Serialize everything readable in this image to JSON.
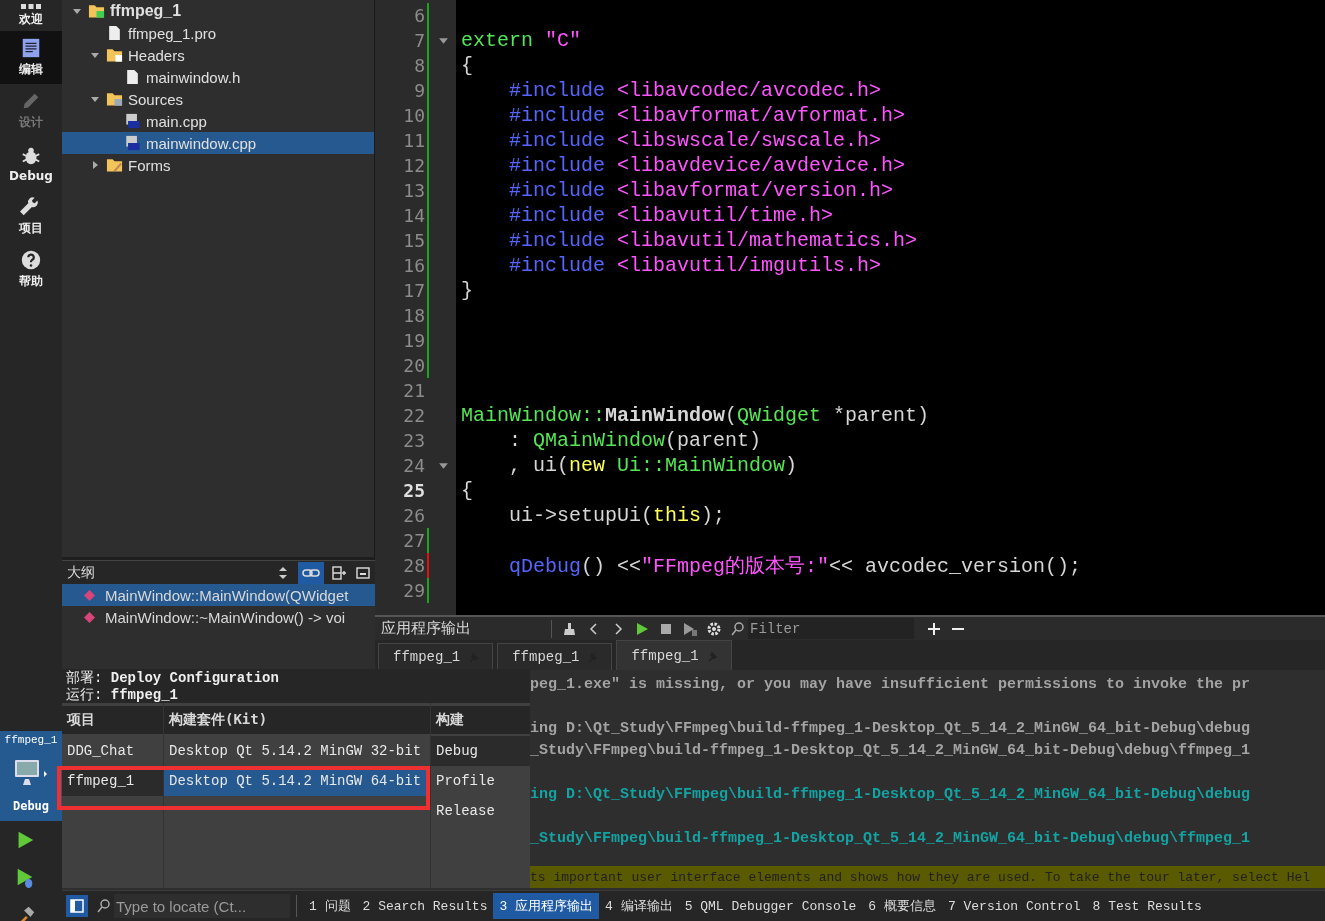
{
  "mode_bar": {
    "modes": [
      {
        "label": "欢迎",
        "kind": "welcome",
        "selected": false,
        "disabled": false
      },
      {
        "label": "编辑",
        "kind": "edit",
        "selected": true,
        "disabled": false
      },
      {
        "label": "设计",
        "kind": "design",
        "selected": false,
        "disabled": true
      },
      {
        "label": "Debug",
        "kind": "debug",
        "selected": false,
        "disabled": false
      },
      {
        "label": "项目",
        "kind": "projects",
        "selected": false,
        "disabled": false
      },
      {
        "label": "帮助",
        "kind": "help",
        "selected": false,
        "disabled": false
      }
    ],
    "kit_selector": {
      "project": "ffmpeg_1",
      "build": "Debug"
    }
  },
  "project_tree": [
    {
      "label": "ffmpeg_1",
      "kind": "project",
      "expanded": true,
      "selected": false,
      "children": [
        {
          "label": "ffmpeg_1.pro",
          "kind": "pro-file",
          "selected": false
        },
        {
          "label": "Headers",
          "kind": "header-folder",
          "expanded": true,
          "selected": false,
          "children": [
            {
              "label": "mainwindow.h",
              "kind": "header-file",
              "selected": false
            }
          ]
        },
        {
          "label": "Sources",
          "kind": "source-folder",
          "expanded": true,
          "selected": false,
          "children": [
            {
              "label": "main.cpp",
              "kind": "source-file",
              "selected": false
            },
            {
              "label": "mainwindow.cpp",
              "kind": "source-file",
              "selected": true
            }
          ]
        },
        {
          "label": "Forms",
          "kind": "form-folder",
          "expanded": false,
          "selected": false
        }
      ]
    }
  ],
  "outline": {
    "title": "大纲",
    "items": [
      {
        "label": "MainWindow::MainWindow(QWidget",
        "selected": true
      },
      {
        "label": "MainWindow::~MainWindow() -> voi",
        "selected": false
      }
    ]
  },
  "editor": {
    "lines": [
      {
        "number": "6",
        "fold": false,
        "current": false,
        "added": true,
        "modified": false
      },
      {
        "number": "7",
        "fold": true,
        "current": false,
        "added": true,
        "modified": false,
        "tokens": [
          {
            "kind": "storage",
            "text": "extern"
          },
          {
            "kind": "string",
            "text": " \"C\""
          }
        ]
      },
      {
        "number": "8",
        "fold": false,
        "current": false,
        "added": true,
        "modified": false,
        "tokens": [
          {
            "kind": "plain",
            "text": "{"
          }
        ]
      },
      {
        "number": "9",
        "fold": false,
        "current": false,
        "added": true,
        "modified": false,
        "tokens": [
          {
            "kind": "preproc",
            "text": "    #include"
          },
          {
            "kind": "string",
            "text": " <libavcodec/avcodec.h>"
          }
        ]
      },
      {
        "number": "10",
        "fold": false,
        "current": false,
        "added": true,
        "modified": false,
        "tokens": [
          {
            "kind": "preproc",
            "text": "    #include"
          },
          {
            "kind": "string",
            "text": " <libavformat/avformat.h>"
          }
        ]
      },
      {
        "number": "11",
        "fold": false,
        "current": false,
        "added": true,
        "modified": false,
        "tokens": [
          {
            "kind": "preproc",
            "text": "    #include"
          },
          {
            "kind": "string",
            "text": " <libswscale/swscale.h>"
          }
        ]
      },
      {
        "number": "12",
        "fold": false,
        "current": false,
        "added": true,
        "modified": false,
        "tokens": [
          {
            "kind": "preproc",
            "text": "    #include"
          },
          {
            "kind": "string",
            "text": " <libavdevice/avdevice.h>"
          }
        ]
      },
      {
        "number": "13",
        "fold": false,
        "current": false,
        "added": true,
        "modified": false,
        "tokens": [
          {
            "kind": "preproc",
            "text": "    #include"
          },
          {
            "kind": "string",
            "text": " <libavformat/version.h>"
          }
        ]
      },
      {
        "number": "14",
        "fold": false,
        "current": false,
        "added": true,
        "modified": false,
        "tokens": [
          {
            "kind": "preproc",
            "text": "    #include"
          },
          {
            "kind": "string",
            "text": " <libavutil/time.h>"
          }
        ]
      },
      {
        "number": "15",
        "fold": false,
        "current": false,
        "added": true,
        "modified": false,
        "tokens": [
          {
            "kind": "preproc",
            "text": "    #include"
          },
          {
            "kind": "string",
            "text": " <libavutil/mathematics.h>"
          }
        ]
      },
      {
        "number": "16",
        "fold": false,
        "current": false,
        "added": true,
        "modified": false,
        "tokens": [
          {
            "kind": "preproc",
            "text": "    #include"
          },
          {
            "kind": "string",
            "text": " <libavutil/imgutils.h>"
          }
        ]
      },
      {
        "number": "17",
        "fold": false,
        "current": false,
        "added": true,
        "modified": false,
        "tokens": [
          {
            "kind": "plain",
            "text": "}"
          }
        ]
      },
      {
        "number": "18",
        "fold": false,
        "current": false,
        "added": true,
        "modified": false
      },
      {
        "number": "19",
        "fold": false,
        "current": false,
        "added": true,
        "modified": false
      },
      {
        "number": "20",
        "fold": false,
        "current": false,
        "added": true,
        "modified": false
      },
      {
        "number": "21",
        "fold": false,
        "current": false,
        "added": false,
        "modified": false
      },
      {
        "number": "22",
        "fold": false,
        "current": false,
        "added": false,
        "modified": false,
        "tokens": [
          {
            "kind": "type",
            "text": "MainWindow::"
          },
          {
            "kind": "name",
            "text": "MainWindow"
          },
          {
            "kind": "plain",
            "text": "("
          },
          {
            "kind": "type",
            "text": "QWidget"
          },
          {
            "kind": "plain",
            "text": " *parent)"
          }
        ]
      },
      {
        "number": "23",
        "fold": false,
        "current": false,
        "added": false,
        "modified": false,
        "tokens": [
          {
            "kind": "plain",
            "text": "    : "
          },
          {
            "kind": "type",
            "text": "QMainWindow"
          },
          {
            "kind": "plain",
            "text": "(parent)"
          }
        ]
      },
      {
        "number": "24",
        "fold": true,
        "current": false,
        "added": false,
        "modified": false,
        "tokens": [
          {
            "kind": "plain",
            "text": "    , ui("
          },
          {
            "kind": "keyword",
            "text": "new"
          },
          {
            "kind": "type",
            "text": " Ui::MainWindow"
          },
          {
            "kind": "plain",
            "text": ")"
          }
        ]
      },
      {
        "number": "25",
        "fold": false,
        "current": true,
        "added": false,
        "modified": false,
        "tokens": [
          {
            "kind": "plain",
            "text": "{"
          }
        ]
      },
      {
        "number": "26",
        "fold": false,
        "current": false,
        "added": false,
        "modified": false,
        "tokens": [
          {
            "kind": "plain",
            "text": "    ui->setupUi("
          },
          {
            "kind": "keyword",
            "text": "this"
          },
          {
            "kind": "plain",
            "text": ");"
          }
        ]
      },
      {
        "number": "27",
        "fold": false,
        "current": false,
        "added": true,
        "modified": false
      },
      {
        "number": "28",
        "fold": false,
        "current": false,
        "added": false,
        "modified": true,
        "tokens": [
          {
            "kind": "preproc",
            "text": "    qDebug"
          },
          {
            "kind": "plain",
            "text": "() <<"
          },
          {
            "kind": "string",
            "text": "\"FFmpeg的版本号:\""
          },
          {
            "kind": "plain",
            "text": "<< avcodec_version();"
          }
        ]
      },
      {
        "number": "29",
        "fold": false,
        "current": false,
        "added": true,
        "modified": false
      }
    ]
  },
  "output": {
    "title": "应用程序输出",
    "filter": {
      "placeholder": "Filter"
    },
    "tabs": [
      {
        "label": "ffmpeg_1",
        "selected": false
      },
      {
        "label": "ffmpeg_1",
        "selected": false
      },
      {
        "label": "ffmpeg_1",
        "selected": true
      }
    ],
    "lines": [
      {
        "text": "peg_1.exe\" is missing, or you may have insufficient permissions to invoke the pr",
        "kind": "error",
        "gap_before": false
      },
      {
        "text": "ing D:\\Qt_Study\\FFmpeg\\build-ffmpeg_1-Desktop_Qt_5_14_2_MinGW_64_bit-Debug\\debug",
        "kind": "error",
        "gap_before": true
      },
      {
        "text": "_Study\\FFmpeg\\build-ffmpeg_1-Desktop_Qt_5_14_2_MinGW_64_bit-Debug\\debug\\ffmpeg_1",
        "kind": "error",
        "gap_before": false
      },
      {
        "text": "ing D:\\Qt_Study\\FFmpeg\\build-ffmpeg_1-Desktop_Qt_5_14_2_MinGW_64_bit-Debug\\debug",
        "kind": "info",
        "gap_before": true
      },
      {
        "text": "_Study\\FFmpeg\\build-ffmpeg_1-Desktop_Qt_5_14_2_MinGW_64_bit-Debug\\debug\\ffmpeg_1",
        "kind": "info",
        "gap_before": true
      }
    ],
    "banner": "ts important user interface elements and shows how they are used. To take the tour later, select Hel"
  },
  "run_popup": {
    "deploy": "部署: **Deploy Configuration**",
    "run": "运行: **ffmpeg_1**",
    "columns": [
      "项目",
      "构建套件(Kit)",
      "构建"
    ],
    "projects": [
      {
        "label": "DDG_Chat",
        "selected": false
      },
      {
        "label": "ffmpeg_1",
        "selected": true
      }
    ],
    "kits": [
      {
        "label": "Desktop Qt 5.14.2 MinGW 32-bit",
        "selected": false
      },
      {
        "label": "Desktop Qt 5.14.2 MinGW 64-bit",
        "selected": true
      }
    ],
    "builds": [
      {
        "label": "Debug",
        "selected": true
      },
      {
        "label": "Profile",
        "selected": false
      },
      {
        "label": "Release",
        "selected": false
      }
    ]
  },
  "status_bar": {
    "locate": {
      "placeholder": "Type to locate (Ct..."
    },
    "tabs": [
      {
        "label": "1 问题",
        "selected": false
      },
      {
        "label": "2 Search Results",
        "selected": false
      },
      {
        "label": "3 应用程序输出",
        "selected": true
      },
      {
        "label": "4 编译输出",
        "selected": false
      },
      {
        "label": "5 QML Debugger Console",
        "selected": false
      },
      {
        "label": "6 概要信息",
        "selected": false
      },
      {
        "label": "7 Version Control",
        "selected": false
      },
      {
        "label": "8 Test Results",
        "selected": false
      }
    ]
  }
}
